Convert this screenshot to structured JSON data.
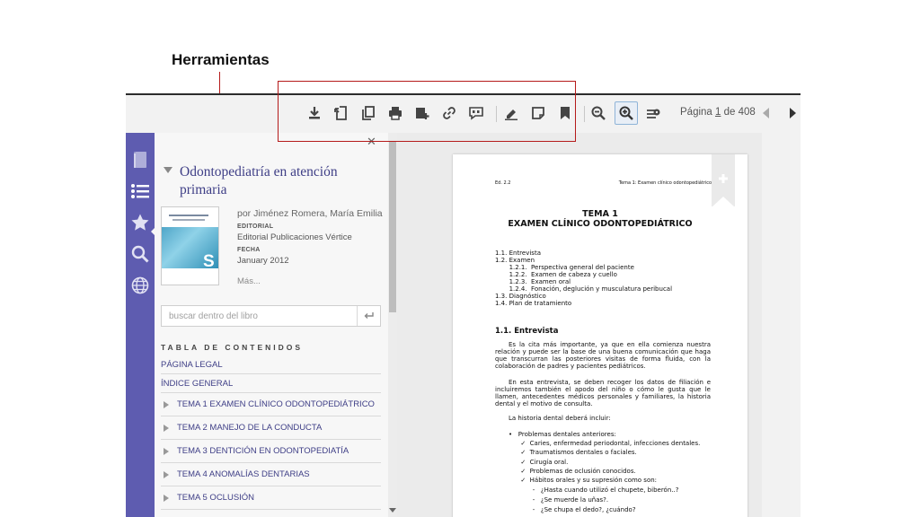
{
  "annotation": {
    "label": "Herramientas"
  },
  "toolbar": {
    "buttons": [
      {
        "name": "download",
        "icon": "download-icon"
      },
      {
        "name": "export",
        "icon": "export-icon"
      },
      {
        "name": "copy",
        "icon": "copy-icon"
      },
      {
        "name": "print",
        "icon": "print-icon"
      },
      {
        "name": "add-to-collection",
        "icon": "add-document-icon"
      },
      {
        "name": "link",
        "icon": "link-icon"
      },
      {
        "name": "cite",
        "icon": "quote-icon"
      },
      {
        "name": "highlight",
        "icon": "highlighter-icon"
      },
      {
        "name": "note",
        "icon": "note-icon"
      },
      {
        "name": "bookmark",
        "icon": "bookmark-icon"
      },
      {
        "name": "zoom-out",
        "icon": "zoom-out-icon"
      },
      {
        "name": "zoom-in",
        "icon": "zoom-in-icon"
      },
      {
        "name": "view-settings",
        "icon": "view-settings-icon"
      }
    ],
    "page_indicator": {
      "prefix": "Página",
      "current": "1",
      "separator": "de",
      "total": "408"
    }
  },
  "rail": {
    "items": [
      {
        "name": "library",
        "icon": "book-icon"
      },
      {
        "name": "contents",
        "icon": "list-icon",
        "active": true
      },
      {
        "name": "favorites",
        "icon": "star-icon"
      },
      {
        "name": "search",
        "icon": "search-icon"
      },
      {
        "name": "web",
        "icon": "globe-icon"
      }
    ],
    "color": "#5e5cb0"
  },
  "book": {
    "title": "Odontopediatría en atención primaria",
    "author": "por Jiménez Romera, María Emilia",
    "editorial_label": "EDITORIAL",
    "editorial": "Editorial Publicaciones Vértice",
    "date_label": "FECHA",
    "date": "January 2012",
    "more": "Más...",
    "cover_letter": "S"
  },
  "search": {
    "placeholder": "buscar dentro del libro"
  },
  "toc": {
    "heading": "TABLA DE CONTENIDOS",
    "items": [
      {
        "label": "PÁGINA LEGAL",
        "expandable": false
      },
      {
        "label": "ÍNDICE GENERAL",
        "expandable": false
      },
      {
        "label": "TEMA 1 EXAMEN CLÍNICO ODONTOPEDIÁTRICO",
        "expandable": true
      },
      {
        "label": "TEMA 2 MANEJO DE LA CONDUCTA",
        "expandable": true
      },
      {
        "label": "TEMA 3 DENTICIÓN EN ODONTOPEDIATÍA",
        "expandable": true
      },
      {
        "label": "TEMA 4 ANOMALÍAS DENTARIAS",
        "expandable": true
      },
      {
        "label": "TEMA 5 OCLUSIÓN",
        "expandable": true
      }
    ]
  },
  "page": {
    "header_left": "Ed. 2.2",
    "header_right": "Tema 1: Examen clínico odontopediátrico",
    "title1": "TEMA 1",
    "title2": "EXAMEN CLÍNICO ODONTOPEDIÁTRICO",
    "contents": [
      "1.1. Entrevista",
      "1.2. Examen",
      "       1.2.1.  Perspectiva general del paciente",
      "       1.2.2.  Examen de cabeza y cuello",
      "       1.2.3.  Examen oral",
      "       1.2.4.  Fonación, deglución y musculatura peribucal",
      "1.3. Diagnóstico",
      "1.4. Plan de tratamiento"
    ],
    "section": "1.1. Entrevista",
    "para1": "Es la cita más importante, ya que en ella comienza nuestra relación y puede ser la base de una buena comunicación que haga que transcurran las posteriores visitas de forma fluida, con la colaboración de padres y pacientes pediátricos.",
    "para2": "En esta entrevista, se deben recoger los datos de filiación e incluiremos también el apodo del niño o cómo le gusta que le llamen, antecedentes médicos personales y familiares, la historia dental y el motivo de consulta.",
    "para3": "La historia dental deberá incluir:",
    "bullets": [
      "•   Problemas dentales anteriores:",
      "      ✓  Caries, enfermedad periodontal, infecciones dentales.",
      "      ✓  Traumatismos dentales o faciales.",
      "      ✓  Cirugía oral.",
      "      ✓  Problemas de oclusión conocidos.",
      "      ✓  Hábitos orales y su supresión como son:",
      "            -   ¿Hasta cuando utilizó el chupete, biberón..?",
      "            -   ¿Se muerde la uñas?.",
      "            -   ¿Se chupa el dedo?, ¿cuándo?"
    ]
  }
}
